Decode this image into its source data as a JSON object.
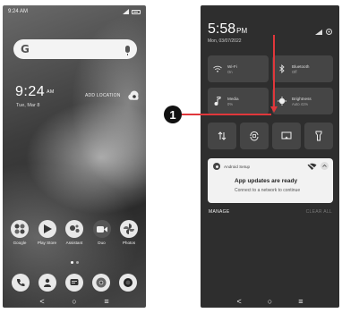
{
  "home": {
    "status_time": "9:24 AM",
    "clock_time": "9:24",
    "clock_ampm": "AM",
    "date": "Tue, Mar 8",
    "add_location": "ADD LOCATION",
    "search_logo": "G",
    "apps": [
      {
        "label": "Google",
        "icon": "google-folder-icon"
      },
      {
        "label": "Play Store",
        "icon": "play-store-icon"
      },
      {
        "label": "Assistant",
        "icon": "assistant-icon"
      },
      {
        "label": "Duo",
        "icon": "duo-icon"
      },
      {
        "label": "Photos",
        "icon": "photos-icon"
      }
    ],
    "dock": [
      "phone-icon",
      "contacts-icon",
      "messages-icon",
      "chrome-icon",
      "camera-icon"
    ],
    "nav": {
      "back": "<",
      "home": "○",
      "recents": "≡"
    }
  },
  "quick_settings": {
    "time": "5:58",
    "ampm": "PM",
    "date": "Mon, 03/07/2022",
    "tiles": [
      {
        "name": "Wi-Fi",
        "state": "On",
        "icon": "wifi-icon"
      },
      {
        "name": "Bluetooth",
        "state": "Off",
        "icon": "bluetooth-icon"
      },
      {
        "name": "Media",
        "state": "0%",
        "icon": "music-note-icon"
      },
      {
        "name": "Brightness",
        "state": "Auto 41%",
        "icon": "brightness-icon"
      }
    ],
    "small_tiles": [
      "data-transfer-icon",
      "auto-rotate-icon",
      "screen-cast-icon",
      "flashlight-icon"
    ],
    "notification": {
      "app": "Android Setup",
      "title": "App updates are ready",
      "body": "Connect to a network to continue"
    },
    "manage": "MANAGE",
    "clear_all": "CLEAR ALL",
    "nav": {
      "back": "<",
      "home": "○",
      "recents": "≡"
    }
  },
  "annotation": {
    "number": "1",
    "color": "#e0373b"
  }
}
